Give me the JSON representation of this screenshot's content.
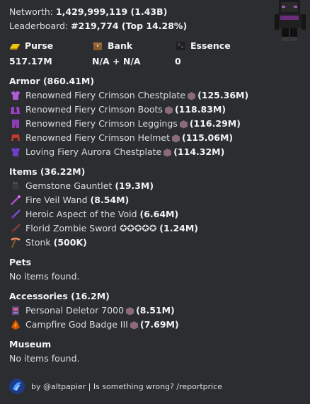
{
  "header": {
    "networth_label": "Networth:",
    "networth_value": "1,429,999,119 (1.43B)",
    "leaderboard_label": "Leaderboard:",
    "leaderboard_value": "#219,774 (Top 14.28%)"
  },
  "stats": {
    "purse_label": "Purse",
    "purse_value": "517.17M",
    "bank_label": "Bank",
    "bank_value": "N/A + N/A",
    "essence_label": "Essence",
    "essence_value": "0"
  },
  "armor": {
    "title": "Armor (860.41M)",
    "items": [
      {
        "name": "Renowned Fiery Crimson Chestplate",
        "value": "(125.36M)",
        "icon_color": "#b05cd6"
      },
      {
        "name": "Renowned Fiery Crimson Boots",
        "value": "(118.83M)",
        "icon_color": "#9a3fc7"
      },
      {
        "name": "Renowned Fiery Crimson Leggings",
        "value": "(116.29M)",
        "icon_color": "#8e3bb8"
      },
      {
        "name": "Renowned Fiery Crimson Helmet",
        "value": "(115.06M)",
        "icon_color": "#c0392b"
      },
      {
        "name": "Loving Fiery Aurora Chestplate",
        "value": "(114.32M)",
        "icon_color": "#6c3fc7"
      }
    ]
  },
  "items": {
    "title": "Items (36.22M)",
    "list": [
      {
        "name": "Gemstone Gauntlet",
        "value": "(19.3M)",
        "icon": "gauntlet-icon"
      },
      {
        "name": "Fire Veil Wand",
        "value": "(8.54M)",
        "icon": "wand-icon"
      },
      {
        "name": "Heroic Aspect of the Void",
        "value": "(6.64M)",
        "icon": "sword-icon"
      },
      {
        "name": "Florid Zombie Sword",
        "stars": "✪✪✪✪✪",
        "value": "(1.24M)",
        "icon": "zombie-sword-icon"
      },
      {
        "name": "Stonk",
        "value": "(500K)",
        "icon": "pickaxe-icon"
      }
    ]
  },
  "pets": {
    "title": "Pets",
    "empty": "No items found."
  },
  "accessories": {
    "title": "Accessories (16.2M)",
    "list": [
      {
        "name": "Personal Deletor 7000",
        "value": "(8.51M)"
      },
      {
        "name": "Campfire God Badge III",
        "value": "(7.69M)"
      }
    ]
  },
  "museum": {
    "title": "Museum",
    "empty": "No items found."
  },
  "footer": {
    "text": "by @altpapier | Is something wrong? /reportprice"
  }
}
